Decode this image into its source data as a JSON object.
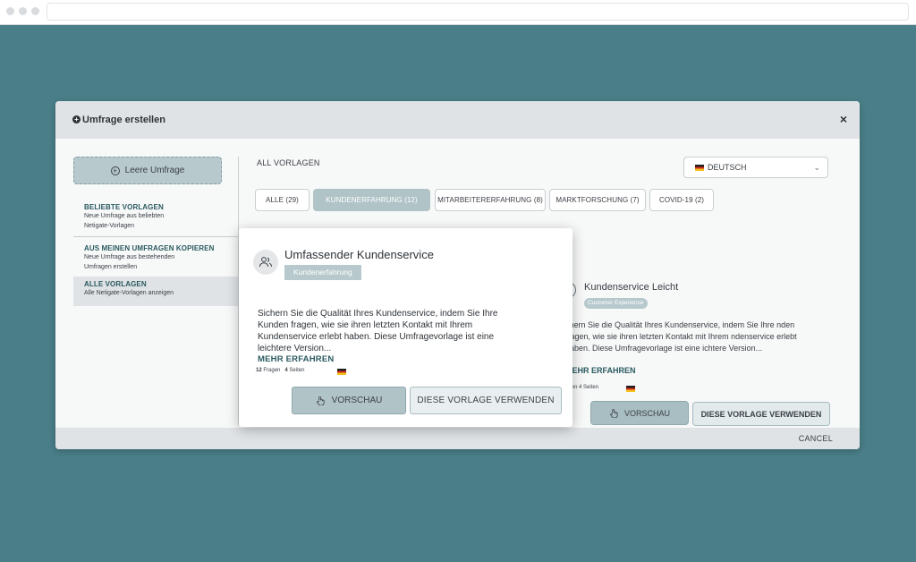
{
  "modal": {
    "title": "Umfrage erstellen",
    "close": "×",
    "cancel": "CANCEL"
  },
  "sidebar": {
    "empty_button": "Leere Umfrage",
    "items": [
      {
        "title": "BELIEBTE VORLAGEN",
        "desc1": "Neue Umfrage aus beliebten",
        "desc2": "Netigate-Vorlagen"
      },
      {
        "title": "AUS MEINEN UMFRAGEN KOPIEREN",
        "desc1": "Neue Umfrage aus bestehenden",
        "desc2": "Umfragen erstellen"
      },
      {
        "title": "ALLE VORLAGEN",
        "desc1": "Alle Netigate-Vorlagen anzeigen",
        "desc2": ""
      }
    ]
  },
  "main": {
    "heading": "ALL VORLAGEN",
    "language": "DEUTSCH",
    "tabs": [
      {
        "label": "ALLE (29)"
      },
      {
        "label": "KUNDENERFAHRUNG (12)"
      },
      {
        "label": "MITARBEITERERFAHRUNG (8)"
      },
      {
        "label": "MARKTFORSCHUNG (7)"
      },
      {
        "label": "COVID-19 (2)"
      }
    ]
  },
  "bg_card": {
    "title": "Kundenservice Leicht",
    "badge": "Customer Experience",
    "desc": "chern Sie die Qualität Ihres Kundenservice, indem Sie Ihre nden fragen, wie sie ihren letzten Kontakt mit Ihrem ndenservice erlebt haben. Diese Umfragevorlage ist eine ichtere Version...",
    "more": "MEHR ERFAHREN",
    "meta": "agen  4 Seiten",
    "preview": "VORSCHAU",
    "use": "DIESE VORLAGE VERWENDEN"
  },
  "card": {
    "title": "Umfassender Kundenservice",
    "badge": "Kundenerfahrung",
    "desc": "Sichern Sie die Qualität Ihres Kundenservice, indem Sie Ihre Kunden fragen, wie sie ihren letzten Kontakt mit Ihrem Kundenservice erlebt haben. Diese Umfragevorlage ist eine leichtere Version...",
    "more": "MEHR ERFAHREN",
    "questions_num": "12",
    "questions_label": "Fragen",
    "pages_num": "4",
    "pages_label": "Seiten",
    "preview": "VORSCHAU",
    "use": "DIESE VORLAGE VERWENDEN"
  },
  "colors": {
    "background": "#4a7f89",
    "accent": "#2a5a5f",
    "badge": "#b7c9cd"
  }
}
